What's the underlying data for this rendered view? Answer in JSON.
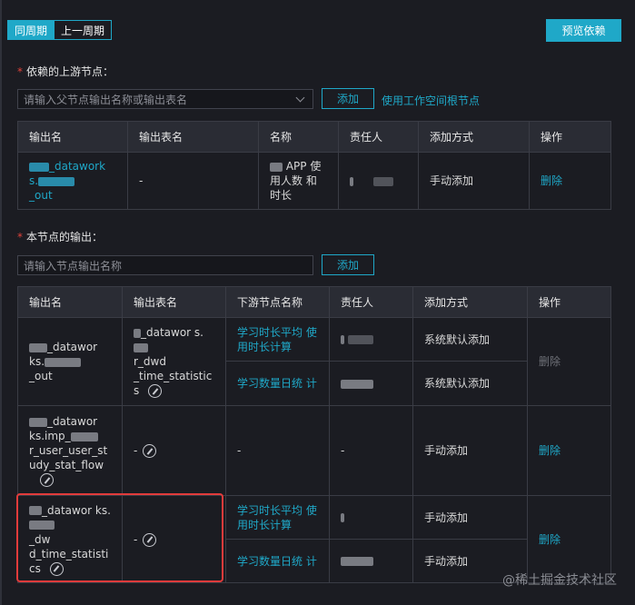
{
  "header": {
    "tab_current": "同周期",
    "tab_previous": "上一周期",
    "preview_button": "预览依赖"
  },
  "upstream": {
    "label": "依赖的上游节点：",
    "required_mark": "*",
    "search_placeholder": "请输入父节点输出名称或输出表名",
    "add_button": "添加",
    "root_link": "使用工作空间根节点",
    "columns": [
      "输出名",
      "输出表名",
      "名称",
      "责任人",
      "添加方式",
      "操作"
    ],
    "rows": [
      {
        "output_name": "_datawork s.",
        "output_name_tail": "_out",
        "output_table": "-",
        "name": "APP 使用人数 和时长",
        "owner": "",
        "add_method": "手动添加",
        "action": "删除"
      }
    ]
  },
  "outputs": {
    "label": "本节点的输出：",
    "required_mark": "*",
    "input_placeholder": "请输入节点输出名称",
    "add_button": "添加",
    "columns": [
      "输出名",
      "输出表名",
      "下游节点名称",
      "责任人",
      "添加方式",
      "操作"
    ],
    "rows": [
      {
        "output_name": "_datawor ks.",
        "output_name_tail": "_out",
        "output_table": "_datawor s.",
        "output_table_mid": "r_dwd _time_statistic s",
        "downstream": [
          {
            "name": "学习时长平均 使用时长计算",
            "add_method": "系统默认添加"
          },
          {
            "name": "学习数量日统 计",
            "add_method": "系统默认添加"
          }
        ],
        "action": "删除"
      },
      {
        "output_name": "_datawor ks.imp_",
        "output_name_tail": "r_user_user_st udy_stat_flow",
        "output_table": "-",
        "downstream_single": "-",
        "owner": "-",
        "add_method": "手动添加",
        "action": "删除"
      },
      {
        "output_name": "_datawor ks.",
        "output_name_tail": "_dw d_time_statisti cs",
        "output_table": "-",
        "downstream": [
          {
            "name": "学习时长平均 使用时长计算",
            "add_method": "手动添加"
          },
          {
            "name": "学习数量日统 计",
            "add_method": "手动添加"
          }
        ],
        "action": "删除"
      }
    ]
  },
  "watermark": "@稀土掘金技术社区",
  "colors": {
    "accent": "#1fa8c8",
    "background": "#1b1c22",
    "header_bg": "#2a2c34",
    "highlight": "#e23b3b",
    "required": "#e0433b"
  },
  "icons": [
    "chevron-down-icon",
    "edit-icon"
  ]
}
